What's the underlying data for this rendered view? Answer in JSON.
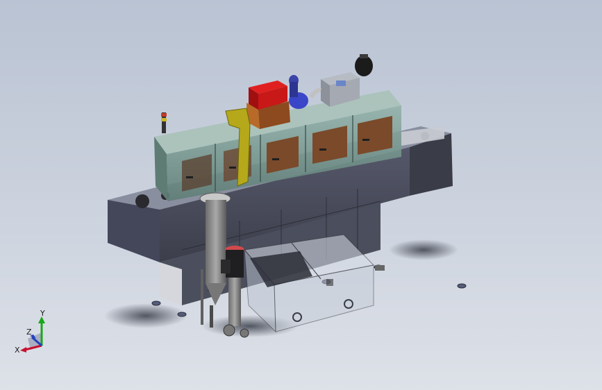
{
  "viewport": {
    "background_top": "#b9c3d3",
    "background_bottom": "#dde1e8"
  },
  "triad": {
    "x_label": "X",
    "y_label": "Y",
    "z_label": "Z",
    "x_color": "#c8102e",
    "y_color": "#1aa51a",
    "z_color": "#1f3fbf"
  },
  "model": {
    "frame_color": "#4a4c58",
    "hood_glass_color": "#6f8f86",
    "door_color": "#7a4a2a",
    "motor_red_color": "#d01818",
    "duct_color": "#b5a81a",
    "pump_motor_color": "#2a2a2a",
    "tank_glass_color": "#cfd6e0"
  }
}
